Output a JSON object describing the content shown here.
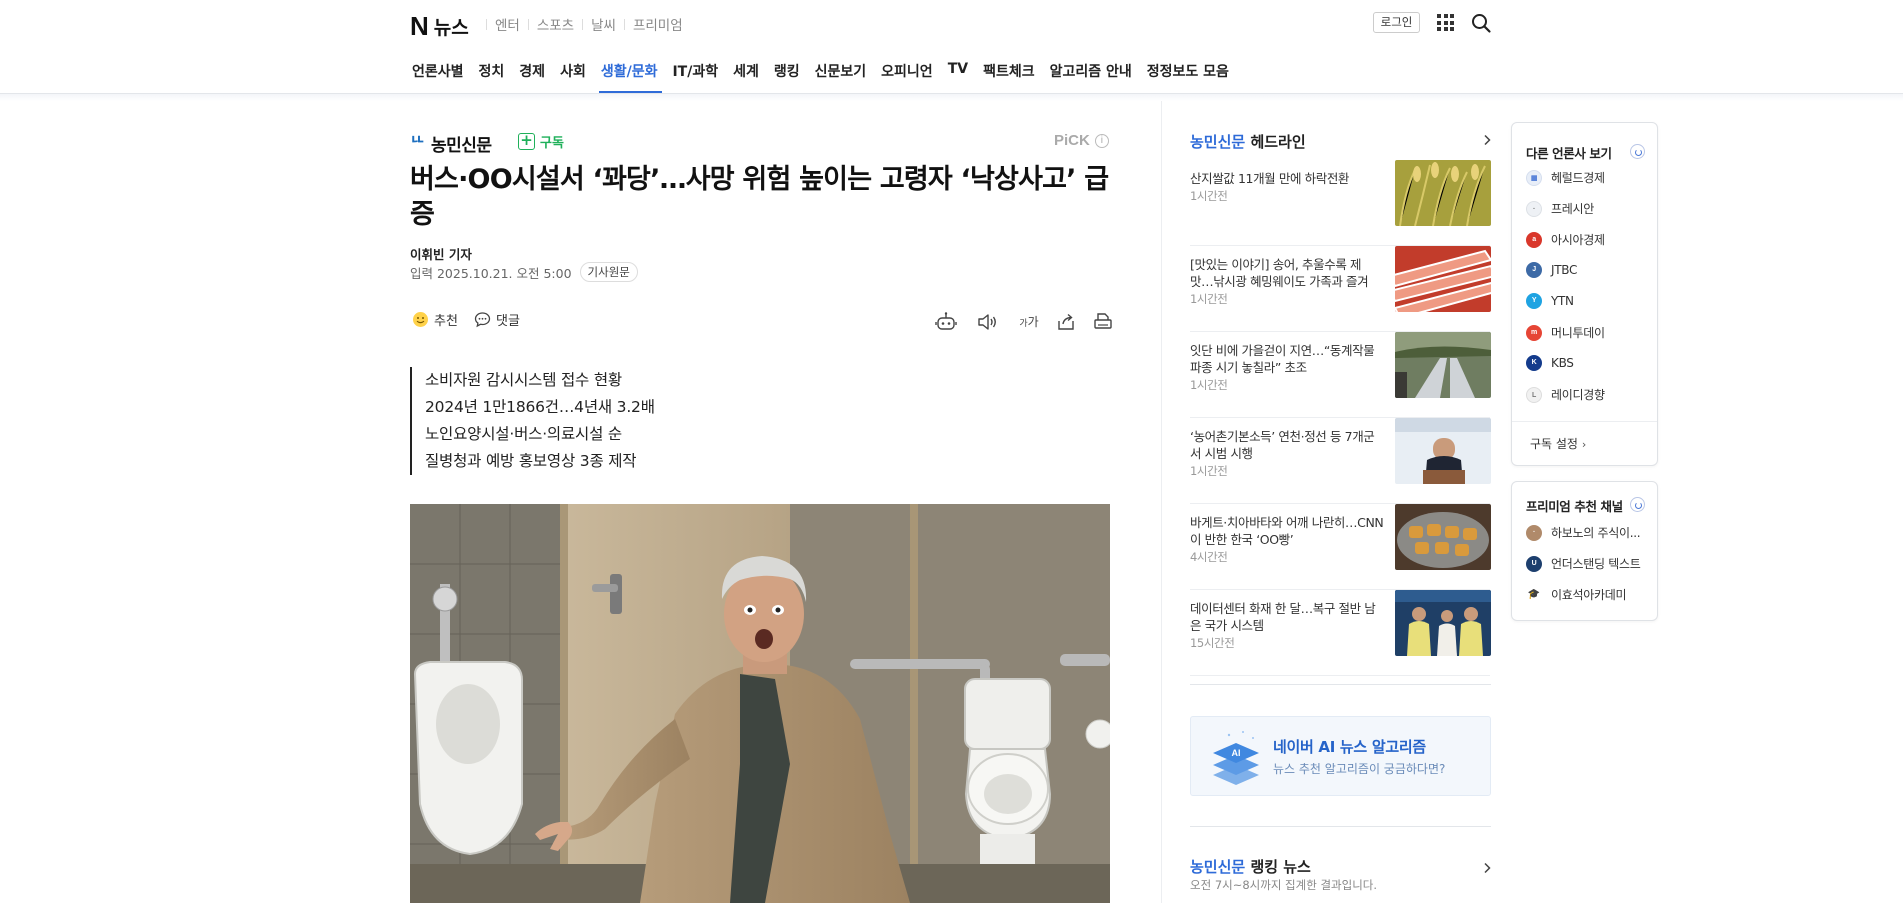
{
  "header": {
    "logo_text": "뉴스",
    "service_links": [
      "엔터",
      "스포츠",
      "날씨",
      "프리미엄"
    ],
    "login_label": "로그인",
    "gnb_tabs": [
      {
        "label": "언론사별"
      },
      {
        "label": "정치"
      },
      {
        "label": "경제"
      },
      {
        "label": "사회"
      },
      {
        "label": "생활/문화",
        "active": true
      },
      {
        "label": "IT/과학"
      },
      {
        "label": "세계"
      },
      {
        "label": "랭킹"
      },
      {
        "label": "신문보기"
      },
      {
        "label": "오피니언"
      },
      {
        "label": "TV"
      },
      {
        "label": "팩트체크"
      },
      {
        "label": "알고리즘 안내"
      },
      {
        "label": "정정보도 모음"
      }
    ]
  },
  "article": {
    "press_name": "농민신문",
    "subscribe_label": "구독",
    "pick_label": "PiCK",
    "headline": "버스·OO시설서 ‘꽈당’…사망 위험 높이는 고령자 ‘낙상사고’ 급증",
    "reporter": "이휘빈 기자",
    "date_label": "입력 2025.10.21. 오전 5:00",
    "original_label": "기사원문",
    "recommend_label": "추천",
    "comment_label": "댓글",
    "summary": [
      "소비자원 감시시스템 접수 현황",
      "2024년 1만1866건…4년새 3.2배",
      "노인요양시설·버스·의료시설 순",
      "질병청과 예방 홍보영상 3종 제작"
    ]
  },
  "headlines": {
    "brand": "농민신문",
    "title": "헤드라인",
    "items": [
      {
        "title": "산지쌀값 11개월 만에 하락전환",
        "time": "1시간전"
      },
      {
        "title": "[맛있는 이야기] 송어, 추울수록 제 맛…낚시광 혜밍웨이도 가족과 즐겨",
        "time": "1시간전"
      },
      {
        "title": "잇단 비에 가을걷이 지연…“동계작물 파종 시기 놓칠라” 초조",
        "time": "1시간전"
      },
      {
        "title": "‘농어촌기본소득’ 연천·정선 등 7개군서 시범 시행",
        "time": "1시간전"
      },
      {
        "title": "바게트·치아바타와 어깨 나란히…CNN이 반한 한국 ‘OO빵’",
        "time": "4시간전"
      },
      {
        "title": "데이터센터 화재 한 달…복구 절반 남은 국가 시스템",
        "time": "15시간전"
      }
    ]
  },
  "ai_banner": {
    "title": "네이버 AI 뉴스 알고리즘",
    "subtitle": "뉴스 추천 알고리즘이 궁금하다면?",
    "badge": "AI"
  },
  "ranking": {
    "brand": "농민신문",
    "title": "랭킹 뉴스",
    "subtitle": "오전 7시~8시까지 집계한 결과입니다."
  },
  "other_press": {
    "title": "다른 언론사 보기",
    "items": [
      {
        "name": "헤럴드경제",
        "color": "#e8eef8"
      },
      {
        "name": "프레시안",
        "color": "#eef1f5"
      },
      {
        "name": "아시아경제",
        "color": "#d9372b"
      },
      {
        "name": "JTBC",
        "color": "#3d6aa6"
      },
      {
        "name": "YTN",
        "color": "#1fa3e2"
      },
      {
        "name": "머니투데이",
        "color": "#e64535"
      },
      {
        "name": "KBS",
        "color": "#143b8c"
      },
      {
        "name": "레이디경향",
        "color": "#f1f1f1"
      }
    ],
    "setting_label": "구독 설정"
  },
  "premium": {
    "title": "프리미엄 추천 채널",
    "items": [
      {
        "name": "하보노의 주식이...",
        "color": "#b08a6a"
      },
      {
        "name": "언더스탠딩 텍스트",
        "color": "#1d3f6e"
      },
      {
        "name": "이효석아카데미",
        "color": "#ffffff"
      }
    ]
  }
}
